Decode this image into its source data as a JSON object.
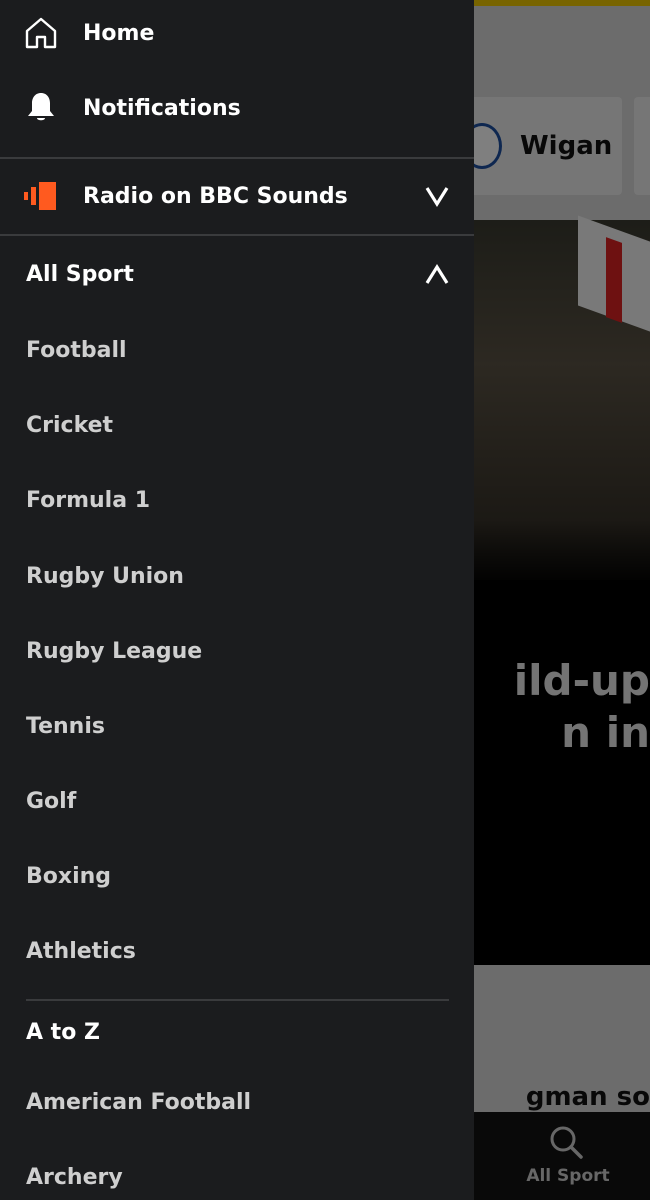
{
  "drawer": {
    "home_label": "Home",
    "notifications_label": "Notifications",
    "radio_label": "Radio on BBC Sounds",
    "all_sport_label": "All Sport",
    "sports": [
      "Football",
      "Cricket",
      "Formula 1",
      "Rugby Union",
      "Rugby League",
      "Tennis",
      "Golf",
      "Boxing",
      "Athletics"
    ],
    "a_to_z_label": "A to Z",
    "a_to_z_items": [
      "American Football",
      "Archery"
    ]
  },
  "background": {
    "team_name": "Wigan",
    "headline_fragment": "ild-up\nn in",
    "headline2_fragment": "gman so",
    "bottom_nav_label": "All Sport"
  },
  "colors": {
    "drawer_bg": "#1b1c1e",
    "sounds_orange": "#ff5a1f",
    "accent_yellow": "#f0c800"
  }
}
